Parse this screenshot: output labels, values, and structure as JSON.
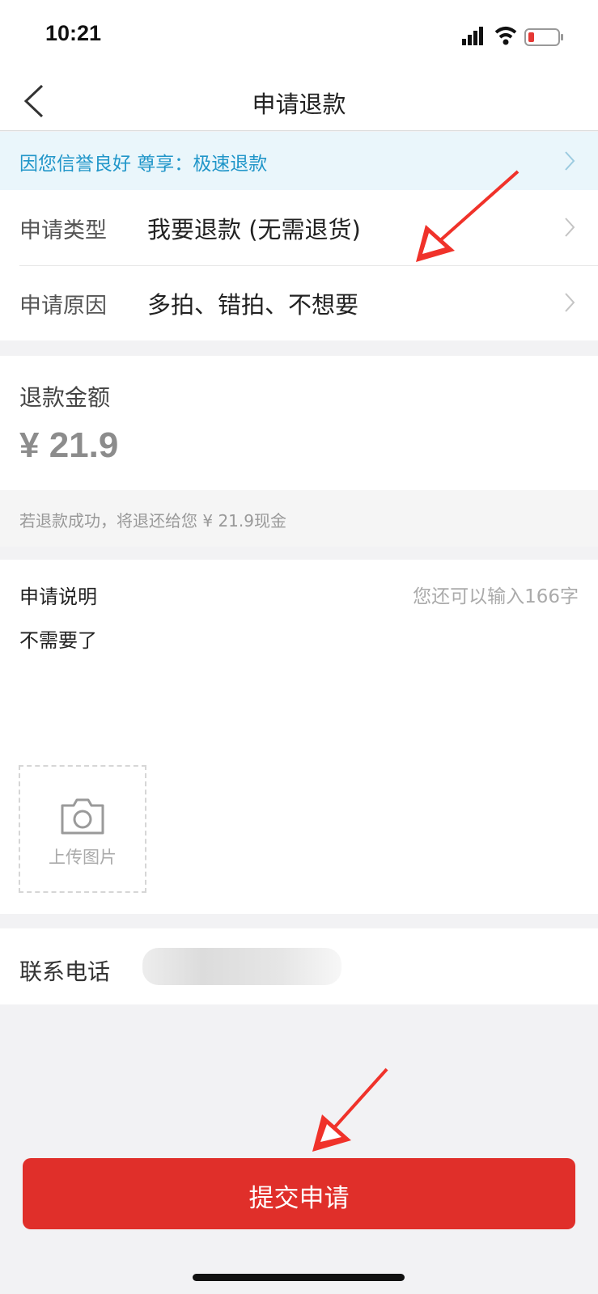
{
  "status": {
    "time": "10:21",
    "icons": [
      "signal-icon",
      "wifi-icon",
      "battery-icon"
    ]
  },
  "nav": {
    "title": "申请退款",
    "back_icon": "chevron-left-icon"
  },
  "banner": {
    "text": "因您信誉良好 尊享：极速退款"
  },
  "application": {
    "type_label": "申请类型",
    "type_value": "我要退款 (无需退货)",
    "reason_label": "申请原因",
    "reason_value": "多拍、错拍、不想要"
  },
  "refund": {
    "amount_label": "退款金额",
    "amount_value": "¥ 21.9",
    "note": "若退款成功，将退还给您 ¥ 21.9现金"
  },
  "description": {
    "label": "申请说明",
    "counter": "您还可以输入166字",
    "text": "不需要了",
    "upload_label": "上传图片"
  },
  "contact": {
    "label": "联系电话"
  },
  "submit": {
    "label": "提交申请"
  },
  "colors": {
    "accent_red": "#e02f2a",
    "banner_blue": "#2196c9",
    "banner_bg": "#eaf6fb"
  }
}
